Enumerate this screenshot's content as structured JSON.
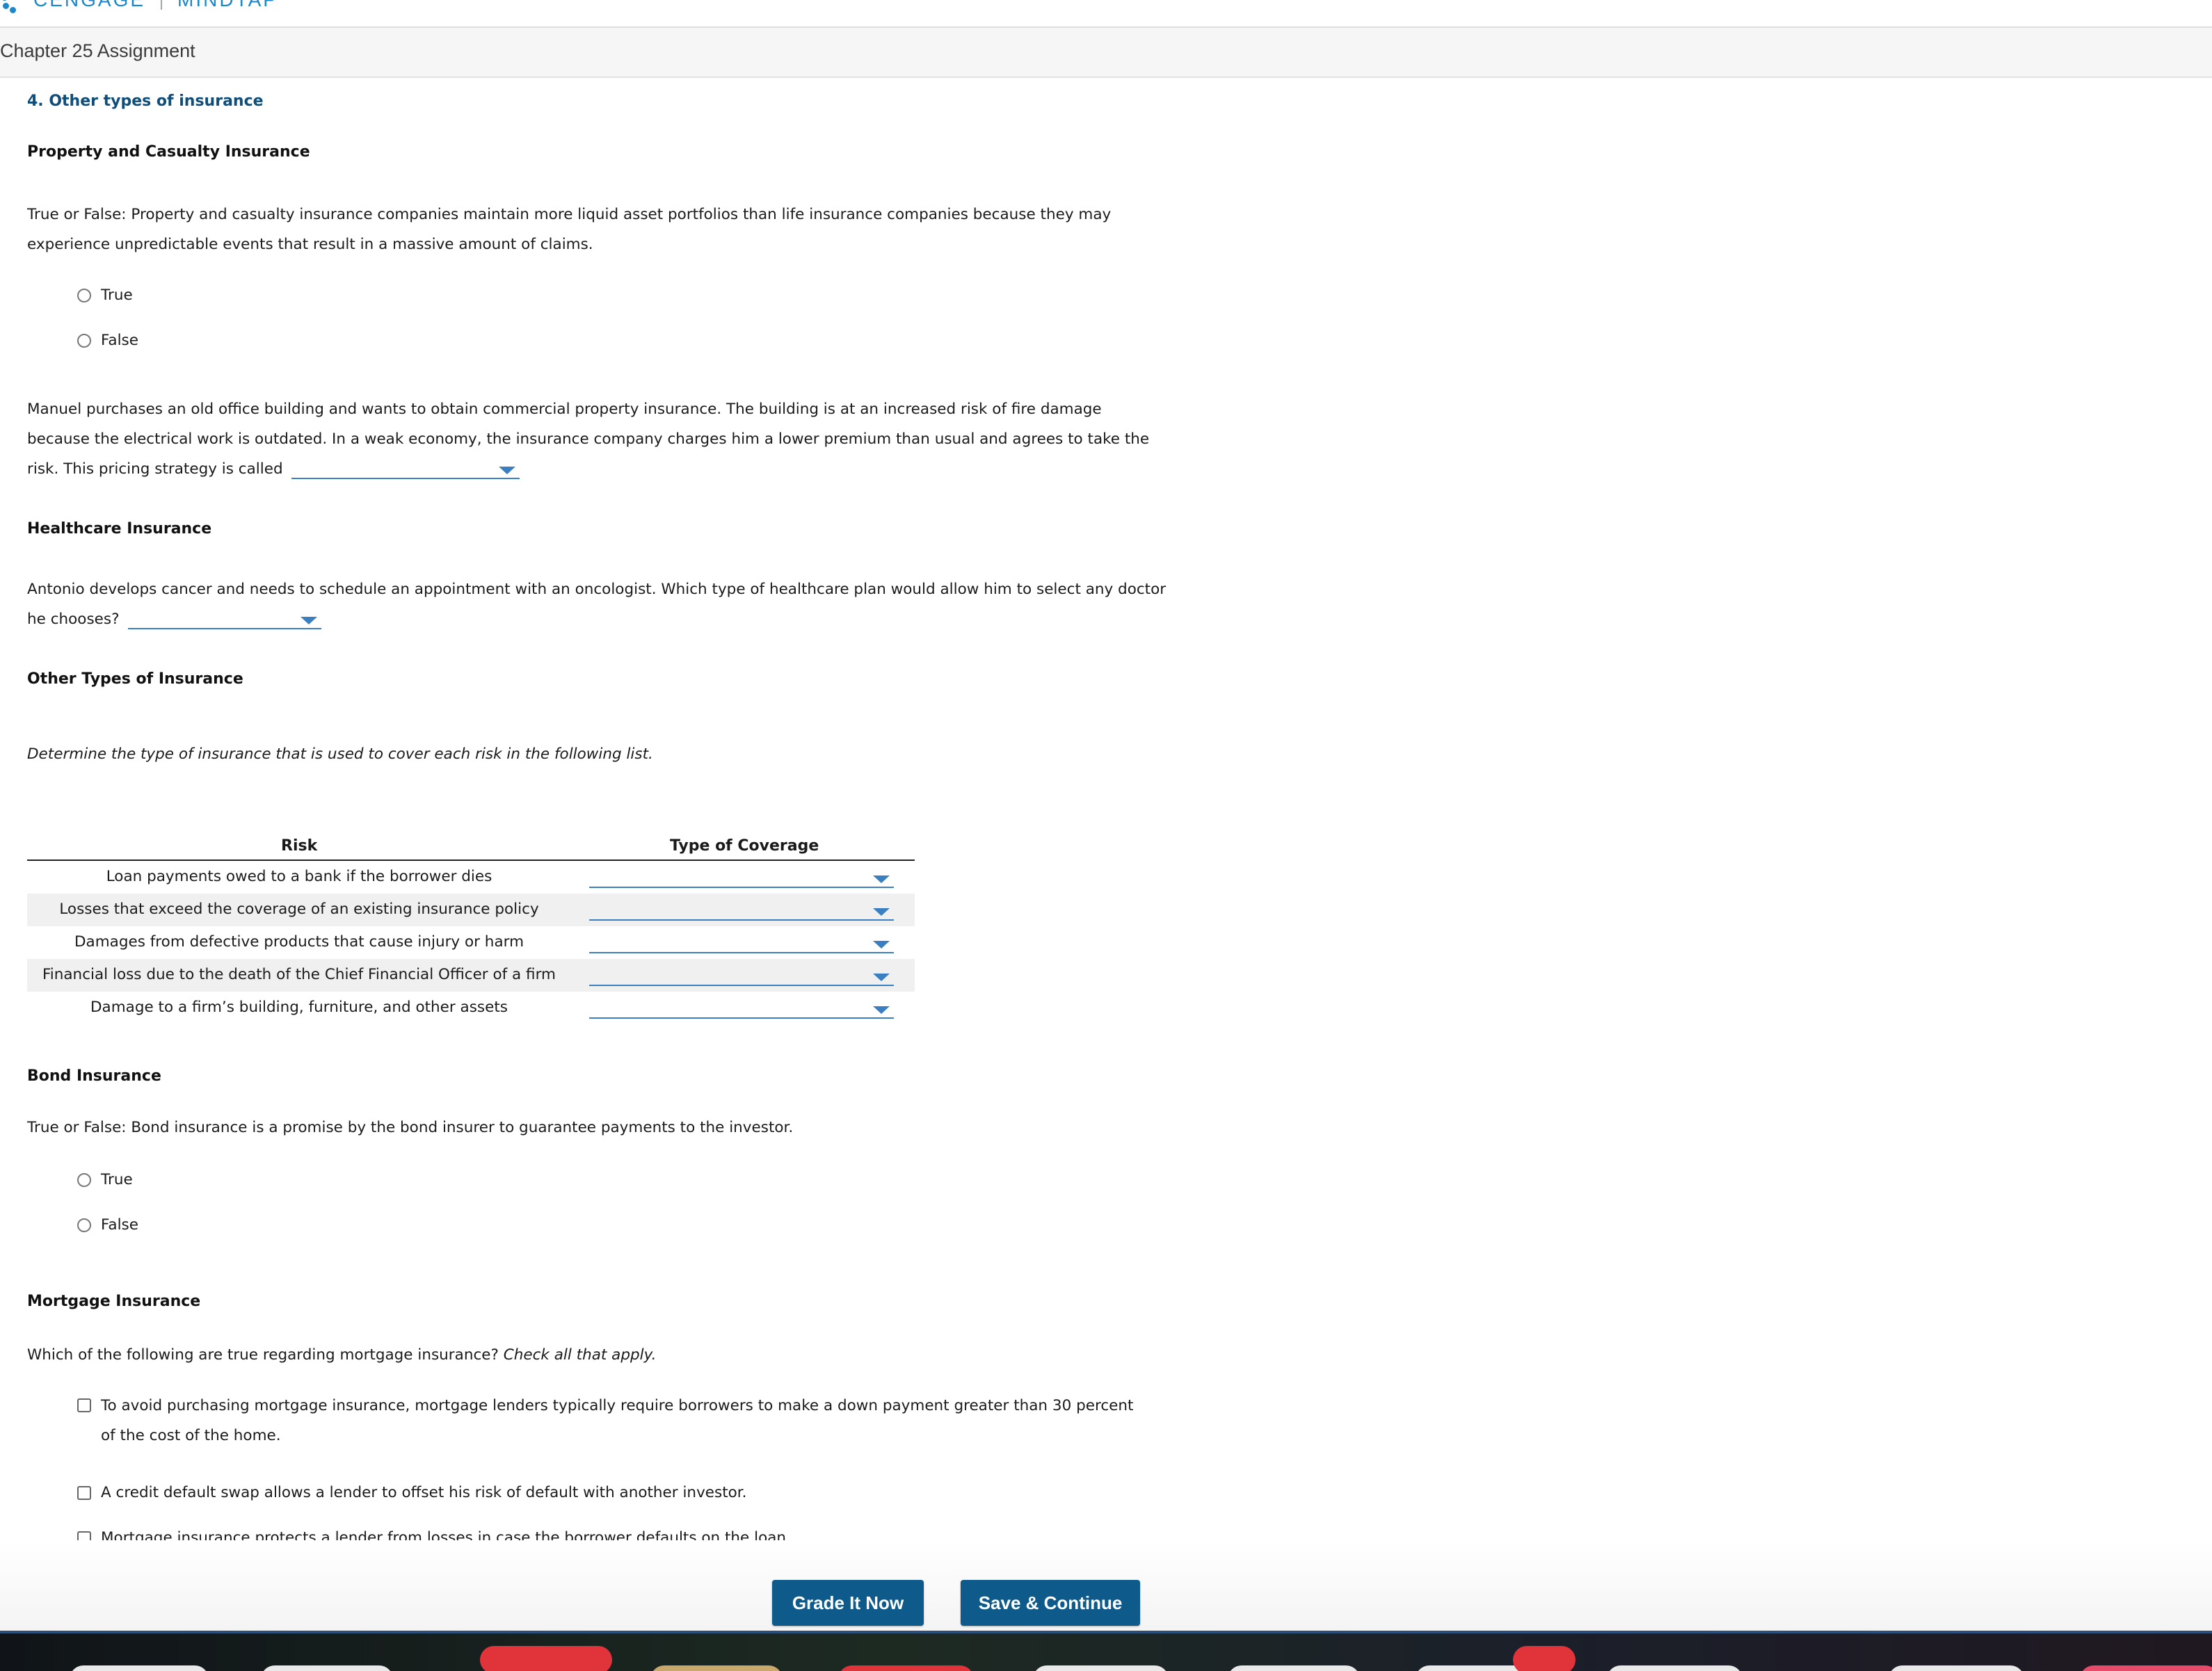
{
  "header": {
    "brand_primary": "CENGAGE",
    "brand_secondary": "MINDTAP"
  },
  "assignment": {
    "title": "Chapter 25 Assignment"
  },
  "question": {
    "number_title": "4. Other types of insurance",
    "property_section": {
      "heading": "Property and Casualty Insurance",
      "tf_prompt_line1": "True or False: Property and casualty insurance companies maintain more liquid asset portfolios than life insurance companies because they may",
      "tf_prompt_line2": "experience unpredictable events that result in a massive amount of claims.",
      "options": [
        "True",
        "False"
      ],
      "manuel_line1": "Manuel purchases an old office building and wants to obtain commercial property insurance. The building is at an increased risk of fire damage",
      "manuel_line2": "because the electrical work is outdated. In a weak economy, the insurance company charges him a lower premium than usual and agrees to take the",
      "manuel_line3": "risk. This pricing strategy is called"
    },
    "healthcare_section": {
      "heading": "Healthcare Insurance",
      "prompt_line1": "Antonio develops cancer and needs to schedule an appointment with an oncologist. Which type of healthcare plan would allow him to select any doctor",
      "prompt_line2": "he chooses?"
    },
    "other_types_section": {
      "heading": "Other Types of Insurance",
      "instruction": "Determine the type of insurance that is used to cover each risk in the following list.",
      "table": {
        "col_risk": "Risk",
        "col_coverage": "Type of Coverage",
        "rows": [
          "Loan payments owed to a bank if the borrower dies",
          "Losses that exceed the coverage of an existing insurance policy",
          "Damages from defective products that cause injury or harm",
          "Financial loss due to the death of the Chief Financial Officer of a firm",
          "Damage to a firm’s building, furniture, and other assets"
        ]
      }
    },
    "bond_section": {
      "heading": "Bond Insurance",
      "prompt": "True or False: Bond insurance is a promise by the bond insurer to guarantee payments to the investor.",
      "options": [
        "True",
        "False"
      ]
    },
    "mortgage_section": {
      "heading": "Mortgage Insurance",
      "prompt": "Which of the following are true regarding mortgage insurance?",
      "prompt_emphasis": "Check all that apply.",
      "options": [
        "To avoid purchasing mortgage insurance, mortgage lenders typically require borrowers to make a down payment greater than 30 percent",
        "of the cost of the home.",
        "A credit default swap allows a lender to offset his risk of default with another investor.",
        "Mortgage insurance protects a lender from losses in case the borrower defaults on the loan."
      ]
    }
  },
  "actions": {
    "grade_label": "Grade It Now",
    "save_label": "Save & Continue"
  },
  "colors": {
    "accent": "#0e5a8a",
    "dropdown": "#3a7fc1",
    "brand": "#1c87c9"
  }
}
